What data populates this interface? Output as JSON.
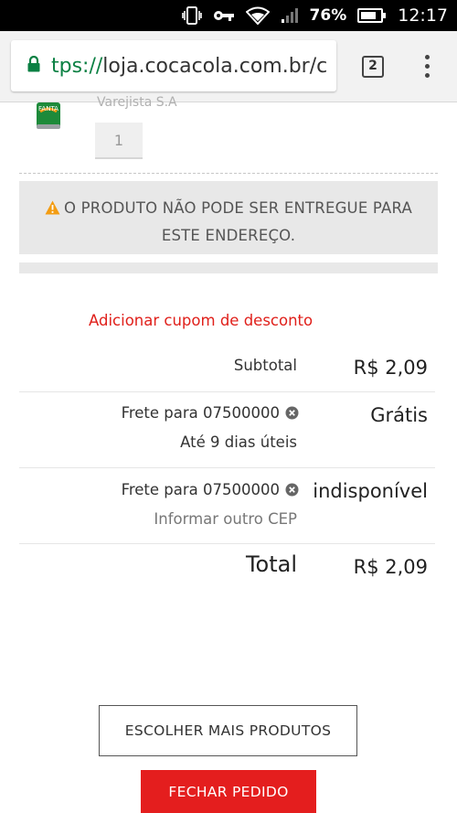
{
  "status_bar": {
    "battery": "76%",
    "time": "12:17",
    "icons": [
      "vibrate-icon",
      "vpn-key-icon",
      "wifi-icon",
      "signal-icon",
      "battery-icon"
    ]
  },
  "browser": {
    "url_scheme": "tps://",
    "url_host": "loja.cocacola.com.br/c",
    "tab_count": "2",
    "icons": [
      "lock-icon",
      "menu-kebab-icon"
    ]
  },
  "product": {
    "seller": "Varejista S.A",
    "quantity": "1"
  },
  "warning": {
    "icon": "warning-triangle-icon",
    "text_line1": "O PRODUTO NÃO PODE SER ENTREGUE PARA",
    "text_line2": "ESTE ENDEREÇO."
  },
  "summary": {
    "coupon_link": "Adicionar cupom de desconto",
    "subtotal_label": "Subtotal",
    "subtotal_value": "R$ 2,09",
    "shipping1": {
      "label": "Frete para 07500000",
      "detail": "Até 9 dias úteis",
      "value": "Grátis"
    },
    "shipping2": {
      "label": "Frete para 07500000",
      "detail": "Informar outro CEP",
      "value": "indisponível"
    },
    "total_label": "Total",
    "total_value": "R$ 2,09"
  },
  "actions": {
    "more_products": "ESCOLHER MAIS PRODUTOS",
    "checkout": "FECHAR PEDIDO"
  },
  "colors": {
    "accent_red": "#e41e1e",
    "link_red": "#e0201b",
    "warning_orange": "#f39c12",
    "secure_green": "#0b8043"
  }
}
